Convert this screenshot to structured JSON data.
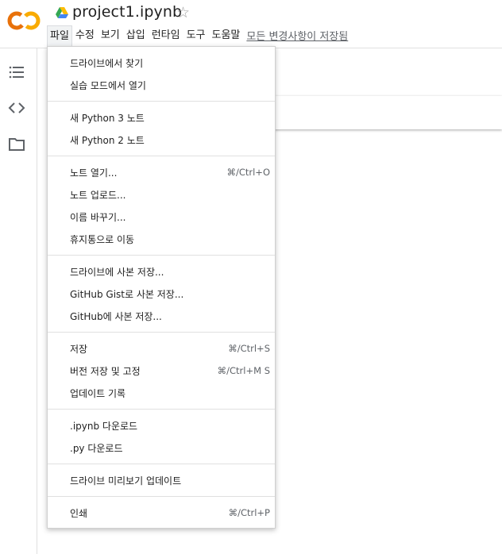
{
  "header": {
    "title": "project1.ipynb",
    "brand_colors": {
      "orange": "#F9AB00",
      "deep_orange": "#E8710A"
    },
    "icons": {
      "logo": "colab-logo",
      "drive": "google-drive-icon",
      "star": "star-outline-icon"
    }
  },
  "menubar": {
    "items": [
      {
        "label": "파일"
      },
      {
        "label": "수정"
      },
      {
        "label": "보기"
      },
      {
        "label": "삽입"
      },
      {
        "label": "런타임"
      },
      {
        "label": "도구"
      },
      {
        "label": "도움말"
      }
    ],
    "status": "모든 변경사항이 저장됨"
  },
  "sidebar": {
    "icons": [
      "table-of-contents-icon",
      "code-snippets-icon",
      "files-folder-icon"
    ]
  },
  "file_menu": {
    "groups": [
      [
        {
          "label": "드라이브에서 찾기",
          "shortcut": ""
        },
        {
          "label": "실습 모드에서 열기",
          "shortcut": ""
        }
      ],
      [
        {
          "label": "새 Python 3 노트",
          "shortcut": ""
        },
        {
          "label": "새 Python 2 노트",
          "shortcut": ""
        }
      ],
      [
        {
          "label": "노트 열기...",
          "shortcut": "⌘/Ctrl+O"
        },
        {
          "label": "노트 업로드...",
          "shortcut": ""
        },
        {
          "label": "이름 바꾸기...",
          "shortcut": ""
        },
        {
          "label": "휴지통으로 이동",
          "shortcut": ""
        }
      ],
      [
        {
          "label": "드라이브에 사본 저장...",
          "shortcut": ""
        },
        {
          "label": "GitHub Gist로 사본 저장...",
          "shortcut": ""
        },
        {
          "label": "GitHub에 사본 저장...",
          "shortcut": ""
        }
      ],
      [
        {
          "label": "저장",
          "shortcut": "⌘/Ctrl+S"
        },
        {
          "label": "버전 저장 및 고정",
          "shortcut": "⌘/Ctrl+M S"
        },
        {
          "label": "업데이트 기록",
          "shortcut": ""
        }
      ],
      [
        {
          "label": ".ipynb 다운로드",
          "shortcut": ""
        },
        {
          "label": ".py 다운로드",
          "shortcut": ""
        }
      ],
      [
        {
          "label": "드라이브 미리보기 업데이트",
          "shortcut": ""
        }
      ],
      [
        {
          "label": "인쇄",
          "shortcut": "⌘/Ctrl+P"
        }
      ]
    ]
  }
}
